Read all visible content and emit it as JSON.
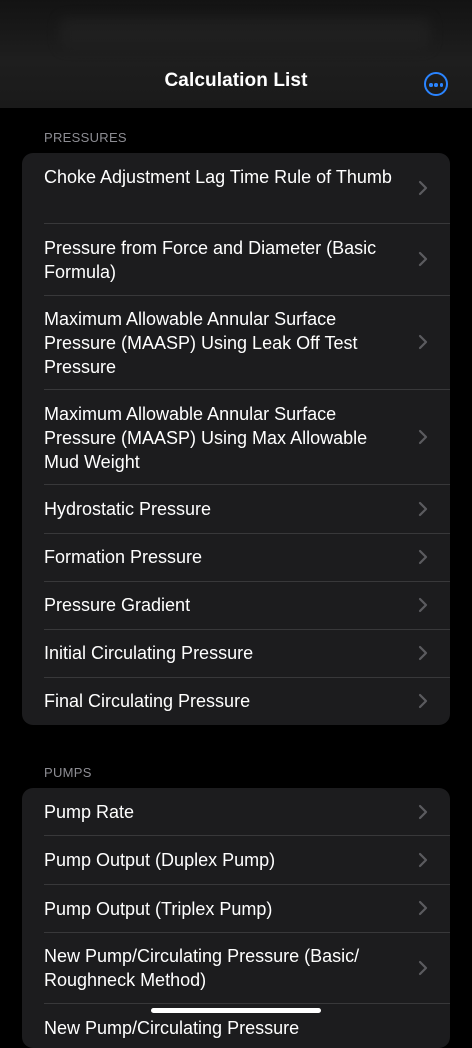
{
  "nav": {
    "title": "Calculation List",
    "more_icon": "ellipsis-circle-icon",
    "accent": "#2a84ff"
  },
  "sections": [
    {
      "header": "PRESSURES",
      "items": [
        "Choke Adjustment Lag Time Rule of Thumb",
        "Pressure from Force and Diameter (Basic Formula)",
        "Maximum Allowable Annular Surface Pressure (MAASP) Using Leak Off Test Pressure",
        "Maximum Allowable Annular Surface Pressure (MAASP) Using Max Allowable Mud Weight",
        "Hydrostatic Pressure",
        "Formation Pressure",
        "Pressure Gradient",
        "Initial Circulating Pressure",
        "Final Circulating Pressure"
      ]
    },
    {
      "header": "PUMPS",
      "items": [
        "Pump Rate",
        "Pump Output (Duplex Pump)",
        "Pump Output (Triplex Pump)",
        "New Pump/Circulating Pressure (Basic/ Roughneck Method)",
        "New Pump/Circulating Pressure"
      ]
    }
  ],
  "chevron_icon": "chevron-right-icon"
}
